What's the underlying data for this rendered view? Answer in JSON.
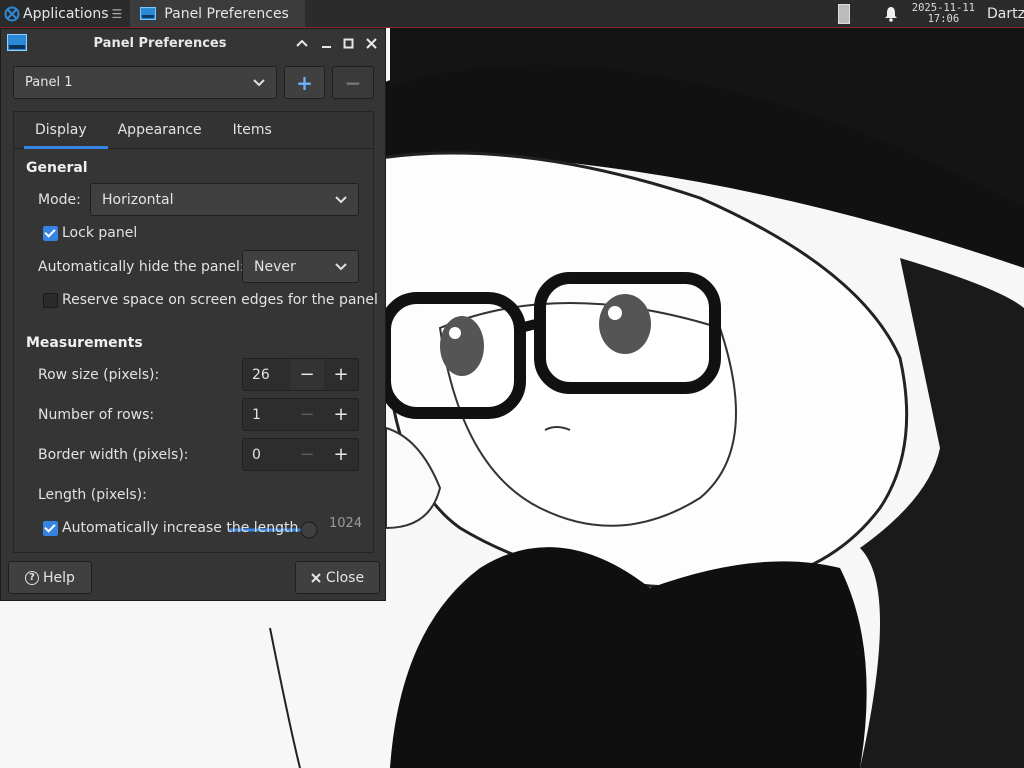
{
  "top_panel": {
    "applications_label": "Applications",
    "menu_separator": "☰",
    "taskbar_item_label": "Panel Preferences",
    "clock_date": "2025-11-11",
    "clock_time": "17:06",
    "user_name": "Dartz"
  },
  "dialog": {
    "title": "Panel Preferences",
    "panel_selected": "Panel 1",
    "add_label": "+",
    "remove_label": "−",
    "tabs": [
      {
        "label": "Display",
        "active": true
      },
      {
        "label": "Appearance",
        "active": false
      },
      {
        "label": "Items",
        "active": false
      }
    ],
    "general": {
      "title": "General",
      "mode_label": "Mode:",
      "mode_value": "Horizontal",
      "lock_panel_label": "Lock panel",
      "lock_panel_checked": true,
      "autohide_label": "Automatically hide the panel:",
      "autohide_value": "Never",
      "reserve_space_label": "Reserve space on screen edges for the panel",
      "reserve_space_checked": false
    },
    "measurements": {
      "title": "Measurements",
      "row_size_label": "Row size (pixels):",
      "row_size_value": "26",
      "rows_label": "Number of rows:",
      "rows_value": "1",
      "border_label": "Border width (pixels):",
      "border_value": "0",
      "length_label": "Length (pixels):",
      "length_value": "1024",
      "auto_length_label": "Automatically increase the length",
      "auto_length_checked": true
    },
    "help_label": "Help",
    "close_label": "Close"
  },
  "colors": {
    "accent": "#3584e4",
    "panel_bg": "#2b2b2b",
    "dialog_bg": "#353535",
    "panel_border": "#8a2330"
  }
}
